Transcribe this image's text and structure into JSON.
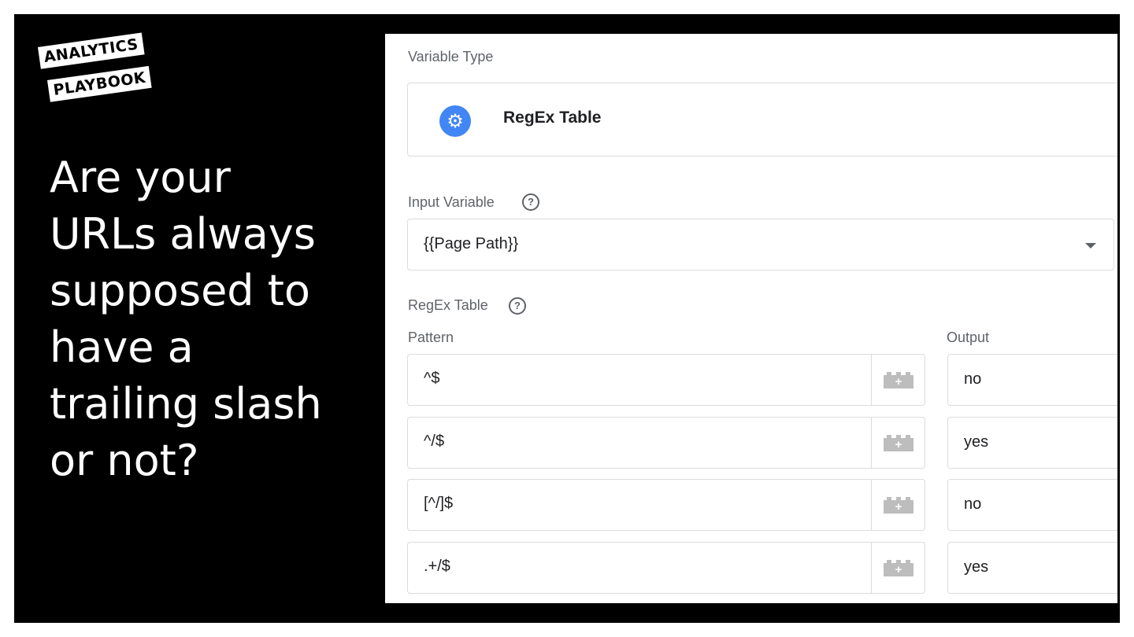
{
  "brand": {
    "line1": "ANALYTICS",
    "line2": "PLAYBOOK"
  },
  "headline": {
    "lines": [
      "Are your",
      "URLs always",
      "supposed to",
      "have a",
      "trailing slash",
      "or not?"
    ]
  },
  "variable_type": {
    "label": "Variable Type",
    "name": "RegEx Table",
    "icon": "gear-icon",
    "icon_color": "#4285f4"
  },
  "input_variable": {
    "label": "Input Variable",
    "value": "{{Page Path}}"
  },
  "regex_table": {
    "label": "RegEx Table",
    "pattern_header": "Pattern",
    "output_header": "Output",
    "rows": [
      {
        "pattern": "^$",
        "output": "no"
      },
      {
        "pattern": "^/$",
        "output": "yes"
      },
      {
        "pattern": "[^/]$",
        "output": "no"
      },
      {
        "pattern": ".+/$",
        "output": "yes"
      }
    ]
  },
  "help_glyph": "?",
  "insert_variable_glyph": "+"
}
